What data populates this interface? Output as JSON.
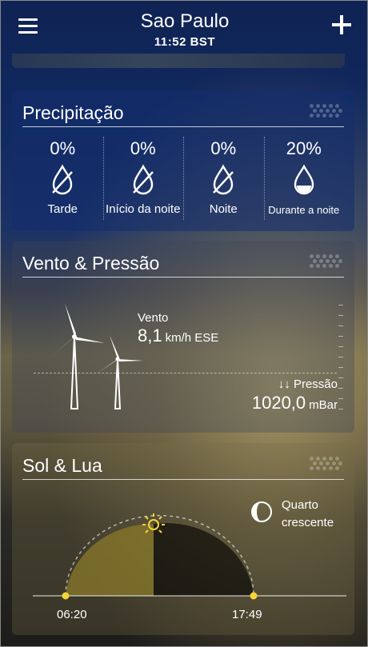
{
  "header": {
    "city": "Sao Paulo",
    "time": "11:52 BST"
  },
  "precipitation": {
    "title": "Precipitação",
    "items": [
      {
        "percent": "0%",
        "label": "Tarde",
        "icon": "no-rain-drop-icon"
      },
      {
        "percent": "0%",
        "label": "Início da noite",
        "icon": "no-rain-drop-icon"
      },
      {
        "percent": "0%",
        "label": "Noite",
        "icon": "no-rain-drop-icon"
      },
      {
        "percent": "20%",
        "label": "Durante a noite",
        "icon": "rain-drop-icon"
      }
    ]
  },
  "wind": {
    "title": "Vento & Pressão",
    "wind_label": "Vento",
    "wind_value": "8,1",
    "wind_unit": "km/h ESE",
    "pressure_label": "↓↓ Pressão",
    "pressure_value": "1020,0",
    "pressure_unit": "mBar"
  },
  "sun_moon": {
    "title": "Sol & Lua",
    "moon_phase_line1": "Quarto",
    "moon_phase_line2": "crescente",
    "sunrise": "06:20",
    "sunset": "17:49"
  },
  "colors": {
    "accent": "#f5d53a",
    "sun_fill": "#8a7a2a"
  }
}
